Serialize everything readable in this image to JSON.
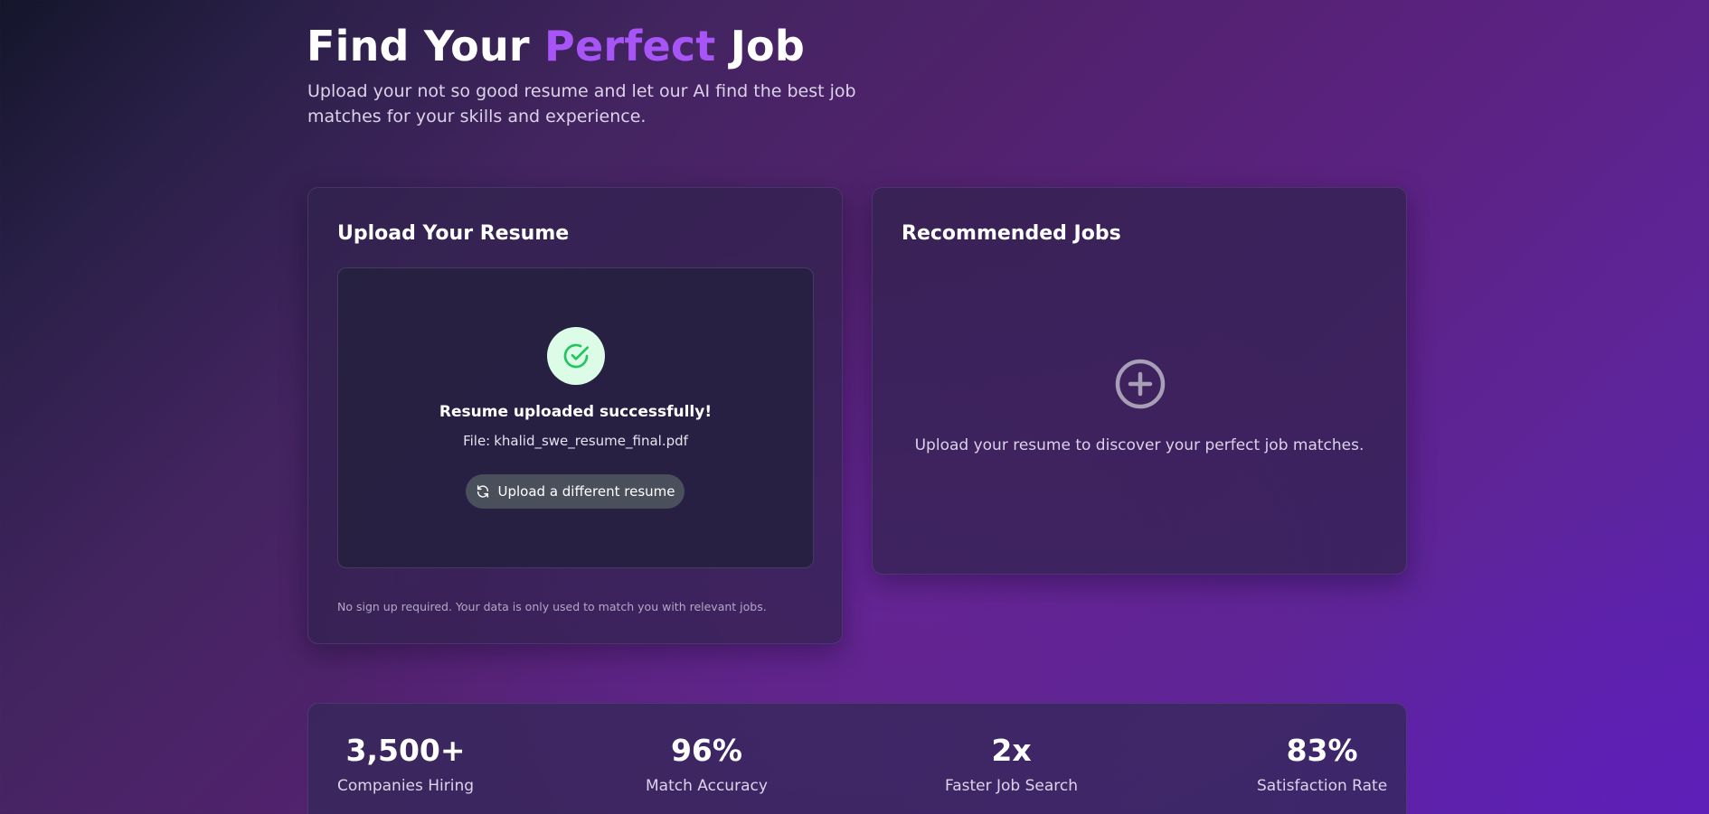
{
  "hero": {
    "title_before": "Find Your",
    "title_accent": "Perfect",
    "title_after": "Job",
    "subtitle": "Upload your not so good resume and let our AI find the best job matches for your skills and experience."
  },
  "upload_card": {
    "title": "Upload Your Resume",
    "status_icon": "check-circle-icon",
    "success_message": "Resume uploaded successfully!",
    "file_label": "File:",
    "file_name": "khalid_swe_resume_final.pdf",
    "reupload_icon": "refresh-icon",
    "reupload_label": "Upload a different resume",
    "privacy_note": "No sign up required. Your data is only used to match you with relevant jobs."
  },
  "jobs_card": {
    "title": "Recommended Jobs",
    "empty_icon": "plus-circle-icon",
    "empty_message": "Upload your resume to discover your perfect job matches."
  },
  "stats": [
    {
      "value": "3,500+",
      "label": "Companies Hiring"
    },
    {
      "value": "96%",
      "label": "Match Accuracy"
    },
    {
      "value": "2x",
      "label": "Faster Job Search"
    },
    {
      "value": "83%",
      "label": "Satisfaction Rate"
    }
  ],
  "colors": {
    "accent": "#a855f7",
    "success_bg": "#dcfce7",
    "success_icon": "#22c55e",
    "button_bg": "#4a4f5c"
  }
}
